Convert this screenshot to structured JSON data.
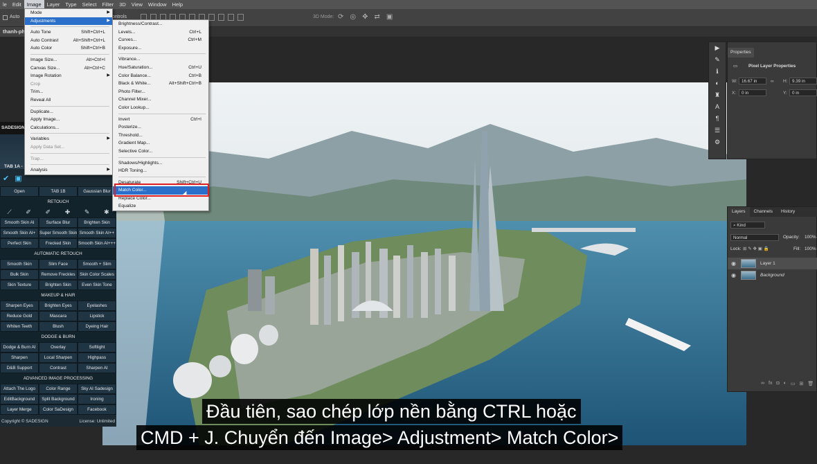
{
  "menubar": {
    "items": [
      "le",
      "Edit",
      "Image",
      "Layer",
      "Type",
      "Select",
      "Filter",
      "3D",
      "View",
      "Window",
      "Help"
    ],
    "active": "Image"
  },
  "options_bar": {
    "auto_label": "Auto",
    "controls_label": "ontrols",
    "mode_3d_label": "3D Mode:"
  },
  "document_tab": {
    "title": "thanh-pho"
  },
  "image_menu": {
    "items": [
      {
        "label": "Mode",
        "shortcut": "",
        "submenu": true,
        "disabled": false
      },
      {
        "label": "Adjustments",
        "shortcut": "",
        "submenu": true,
        "disabled": false,
        "highlight": true
      },
      {
        "sep": true
      },
      {
        "label": "Auto Tone",
        "shortcut": "Shift+Ctrl+L",
        "disabled": false
      },
      {
        "label": "Auto Contrast",
        "shortcut": "Alt+Shift+Ctrl+L",
        "disabled": false
      },
      {
        "label": "Auto Color",
        "shortcut": "Shift+Ctrl+B",
        "disabled": false
      },
      {
        "sep": true
      },
      {
        "label": "Image Size...",
        "shortcut": "Alt+Ctrl+I",
        "disabled": false
      },
      {
        "label": "Canvas Size...",
        "shortcut": "Alt+Ctrl+C",
        "disabled": false
      },
      {
        "label": "Image Rotation",
        "shortcut": "",
        "submenu": true,
        "disabled": false
      },
      {
        "label": "Crop",
        "shortcut": "",
        "disabled": true
      },
      {
        "label": "Trim...",
        "shortcut": "",
        "disabled": false
      },
      {
        "label": "Reveal All",
        "shortcut": "",
        "disabled": false
      },
      {
        "sep": true
      },
      {
        "label": "Duplicate...",
        "shortcut": "",
        "disabled": false
      },
      {
        "label": "Apply Image...",
        "shortcut": "",
        "disabled": false
      },
      {
        "label": "Calculations...",
        "shortcut": "",
        "disabled": false
      },
      {
        "sep": true
      },
      {
        "label": "Variables",
        "shortcut": "",
        "submenu": true,
        "disabled": false
      },
      {
        "label": "Apply Data Set...",
        "shortcut": "",
        "disabled": true
      },
      {
        "sep": true
      },
      {
        "label": "Trap...",
        "shortcut": "",
        "disabled": true
      },
      {
        "sep": true
      },
      {
        "label": "Analysis",
        "shortcut": "",
        "submenu": true,
        "disabled": false
      }
    ]
  },
  "adjustments_menu": {
    "items": [
      {
        "label": "Brightness/Contrast...",
        "shortcut": ""
      },
      {
        "label": "Levels...",
        "shortcut": "Ctrl+L"
      },
      {
        "label": "Curves...",
        "shortcut": "Ctrl+M"
      },
      {
        "label": "Exposure...",
        "shortcut": ""
      },
      {
        "sep": true
      },
      {
        "label": "Vibrance...",
        "shortcut": ""
      },
      {
        "label": "Hue/Saturation...",
        "shortcut": "Ctrl+U"
      },
      {
        "label": "Color Balance...",
        "shortcut": "Ctrl+B"
      },
      {
        "label": "Black & White...",
        "shortcut": "Alt+Shift+Ctrl+B"
      },
      {
        "label": "Photo Filter...",
        "shortcut": ""
      },
      {
        "label": "Channel Mixer...",
        "shortcut": ""
      },
      {
        "label": "Color Lookup...",
        "shortcut": ""
      },
      {
        "sep": true
      },
      {
        "label": "Invert",
        "shortcut": "Ctrl+I"
      },
      {
        "label": "Posterize...",
        "shortcut": ""
      },
      {
        "label": "Threshold...",
        "shortcut": ""
      },
      {
        "label": "Gradient Map...",
        "shortcut": ""
      },
      {
        "label": "Selective Color...",
        "shortcut": ""
      },
      {
        "sep": true
      },
      {
        "label": "Shadows/Highlights...",
        "shortcut": ""
      },
      {
        "label": "HDR Toning...",
        "shortcut": ""
      },
      {
        "sep": true
      },
      {
        "label": "Desaturate",
        "shortcut": "Shift+Ctrl+U"
      },
      {
        "label": "Match Color...",
        "shortcut": "",
        "highlight": true
      },
      {
        "label": "Replace Color...",
        "shortcut": ""
      },
      {
        "label": "Equalize",
        "shortcut": ""
      }
    ]
  },
  "sadesign_panel": {
    "header": "SADESIGN R",
    "tab_title": "TAB 1A -",
    "rows": [
      {
        "cells": [
          "Open",
          "TAB 1B",
          "Gaussian Blur"
        ]
      },
      {
        "section": "RETOUCH"
      },
      {
        "icons": true
      },
      {
        "cells": [
          "Smooth Skin AI",
          "Surface Blur",
          "Brighten Skin"
        ]
      },
      {
        "cells": [
          "Smooth Skin AI+",
          "Super Smooth Skin",
          "Smooth Skin AI++"
        ]
      },
      {
        "cells": [
          "Perfect Skin",
          "Frecked Skin",
          "Smooth Skin AI+++"
        ]
      },
      {
        "section": "AUTOMATIC RETOUCH"
      },
      {
        "cells": [
          "Smooth Skin",
          "Slim Face",
          "Smooth + Slim"
        ]
      },
      {
        "cells": [
          "Bulk Skin",
          "Remove Freckles",
          "Skin Color Scales"
        ]
      },
      {
        "cells": [
          "Skin Texture",
          "Brighten Skin",
          "Even Skin Tone"
        ]
      },
      {
        "section": "MAKEUP & HAIR"
      },
      {
        "cells": [
          "Sharpen Eyes",
          "Brighten Eyes",
          "Eyelashes"
        ]
      },
      {
        "cells": [
          "Reduce Gold",
          "Mascara",
          "Lipstick"
        ]
      },
      {
        "cells": [
          "Whiten Teeth",
          "Blush",
          "Dyeing Hair"
        ]
      },
      {
        "section": "DODGE & BURN"
      },
      {
        "cells": [
          "Dodge & Burn AI",
          "Overlay",
          "Softlight"
        ]
      },
      {
        "cells": [
          "Sharpen",
          "Local Sharpen",
          "Highpass"
        ]
      },
      {
        "cells": [
          "D&B Support",
          "Contrast",
          "Sharpen AI"
        ]
      },
      {
        "section": "ADVANCED IMAGE PROCESSING"
      },
      {
        "cells": [
          "Attach The Logo",
          "Color Range",
          "Sky AI Sadesign"
        ]
      },
      {
        "cells": [
          "EditBackground",
          "Split Background",
          "Ironing"
        ]
      },
      {
        "cells": [
          "Layer Merge",
          "Color SaDesign",
          "Facebook"
        ]
      }
    ],
    "copyright": "Copyright © SADESIGN",
    "license": "License: Unlimited"
  },
  "properties_panel": {
    "tab": "Properties",
    "title": "Pixel Layer Properties",
    "w_label": "W:",
    "w_value": "16.67 in",
    "h_label": "H:",
    "h_value": "9.39 in",
    "x_label": "X:",
    "x_value": "0 in",
    "y_label": "Y:",
    "y_value": "0 in"
  },
  "layers_panel": {
    "tabs": [
      "Layers",
      "Channels",
      "History"
    ],
    "kind_filter": "Kind",
    "blend_mode": "Normal",
    "opacity_label": "Opacity:",
    "opacity_value": "100%",
    "lock_label": "Lock:",
    "fill_label": "Fill:",
    "fill_value": "100%",
    "layers": [
      {
        "name": "Layer 1",
        "selected": true
      },
      {
        "name": "Background",
        "selected": false
      }
    ]
  },
  "subtitles": {
    "line1": "Đầu tiên, sao chép lớp nền bằng CTRL hoặc",
    "line2": "CMD + J. Chuyển đến Image> Adjustment> Match Color>"
  },
  "colors": {
    "menu_highlight": "#2a6fc9",
    "red_box": "#e02020",
    "panel_bg": "#3a3a3a",
    "sadesign_bg": "#1b2a33"
  }
}
